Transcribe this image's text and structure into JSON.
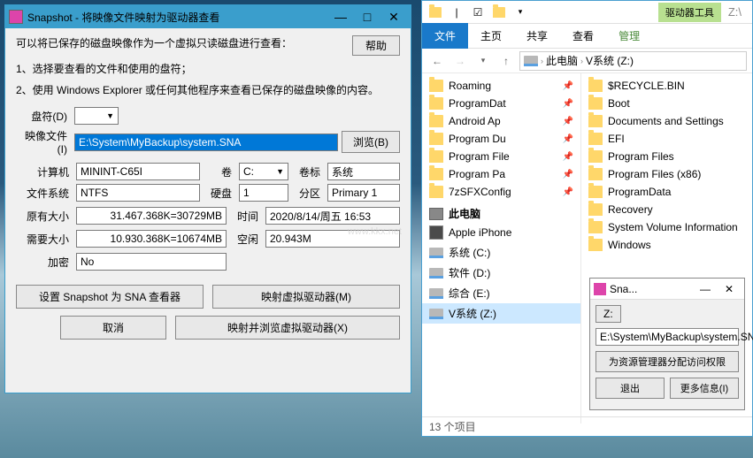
{
  "snapshot": {
    "title": "Snapshot - 将映像文件映射为驱动器查看",
    "help": "帮助",
    "desc1": "可以将已保存的磁盘映像作为一个虚拟只读磁盘进行查看：",
    "step1": "1、选择要查看的文件和使用的盘符；",
    "step2": "2、使用 Windows Explorer 或任何其他程序来查看已保存的磁盘映像的内容。",
    "labels": {
      "drive": "盘符(D)",
      "image": "映像文件(I)",
      "browse": "浏览(B)",
      "computer": "计算机",
      "volume": "卷",
      "vollabel": "卷标",
      "fs": "文件系统",
      "disk": "硬盘",
      "partition": "分区",
      "origsize": "原有大小",
      "time": "时间",
      "needsize": "需要大小",
      "free": "空闲",
      "encrypt": "加密"
    },
    "values": {
      "drive": "",
      "image": "E:\\System\\MyBackup\\system.SNA",
      "computer": "MININT-C65I",
      "volume": "C:",
      "vollabel": "系统",
      "fs": "NTFS",
      "disk": "1",
      "partition": "Primary 1",
      "origsize": "31.467.368K=30729MB",
      "time": "2020/8/14/周五 16:53",
      "needsize": "10.930.368K=10674MB",
      "free": "20.943M",
      "encrypt": "No"
    },
    "buttons": {
      "setviewer": "设置 Snapshot 为 SNA 查看器",
      "mapvirt": "映射虚拟驱动器(M)",
      "cancel": "取消",
      "mapbrowse": "映射并浏览虚拟驱动器(X)"
    },
    "watermark": "www.kkx.net"
  },
  "explorer": {
    "drivetools": "驱动器工具",
    "zlabel": "Z:\\",
    "tabs": {
      "file": "文件",
      "home": "主页",
      "share": "共享",
      "view": "查看",
      "manage": "管理"
    },
    "crumbs": {
      "pc": "此电脑",
      "vol": "V系统 (Z:)"
    },
    "left": {
      "pinned": [
        "Roaming",
        "ProgramDat",
        "Android Ap",
        "Program Du",
        "Program File",
        "Program Pa",
        "7zSFXConfig"
      ],
      "pc_header": "此电脑",
      "devices": [
        {
          "label": "Apple iPhone",
          "type": "phone"
        },
        {
          "label": "系统 (C:)",
          "type": "drive"
        },
        {
          "label": "软件 (D:)",
          "type": "drive"
        },
        {
          "label": "综合 (E:)",
          "type": "drive"
        },
        {
          "label": "V系统 (Z:)",
          "type": "drive",
          "sel": true
        }
      ]
    },
    "right": [
      "$RECYCLE.BIN",
      "Boot",
      "Documents and Settings",
      "EFI",
      "Program Files",
      "Program Files (x86)",
      "ProgramData",
      "Recovery",
      "System Volume Information",
      "Windows"
    ],
    "footer": "13 个项目"
  },
  "snapop": {
    "title": "Sna...",
    "z": "Z:",
    "path": "E:\\System\\MyBackup\\system.SNA",
    "perm": "为资源管理器分配访问权限",
    "exit": "退出",
    "more": "更多信息(I)"
  }
}
